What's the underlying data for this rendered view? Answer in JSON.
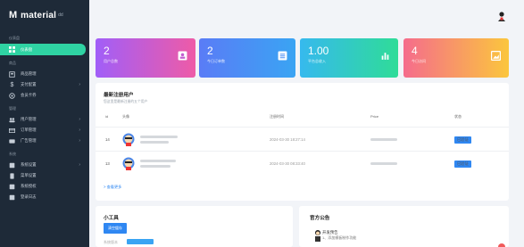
{
  "brand": {
    "logo": "M",
    "name": "material",
    "suffix": "dd"
  },
  "sidebar": {
    "group1": "仪表盘",
    "overview": "仪表盘",
    "group2": "商品",
    "items2": [
      "商品管理",
      "支付配置",
      "会员卡券"
    ],
    "group3": "管理",
    "items3": [
      "用户管理",
      "订单管理",
      "广告管理"
    ],
    "group4": "系统",
    "items4": [
      "系统设置",
      "菜单设置",
      "系统授权",
      "登录日志"
    ]
  },
  "stats": [
    {
      "value": "2",
      "label": "用户总数"
    },
    {
      "value": "2",
      "label": "今日订单数"
    },
    {
      "value": "1.00",
      "label": "平台总收入"
    },
    {
      "value": "4",
      "label": "今日访问"
    }
  ],
  "users": {
    "title": "最新注册用户",
    "subtitle": "您这里是最新注册的五个用户",
    "columns": {
      "id": "id",
      "avatar": "头像",
      "date": "注册时间",
      "price": "Price",
      "status": "状态"
    },
    "rows": [
      {
        "id": "14",
        "date": "2024-03-30 18:27:14",
        "status": "已验证"
      },
      {
        "id": "13",
        "date": "2024-03-30 08:33:40",
        "status": "已验证"
      }
    ],
    "more": "> 查看更多"
  },
  "tools": {
    "title": "小工具",
    "clear": "清空缓存",
    "faint": "系统版本"
  },
  "notice": {
    "title": "官方公告",
    "item_title": "开发预告",
    "item_text": "1、添加模板制作功能"
  },
  "colors": {
    "accent": "#2fd3a3",
    "blue": "#2f87f2",
    "sidebar": "#1e2a38"
  }
}
